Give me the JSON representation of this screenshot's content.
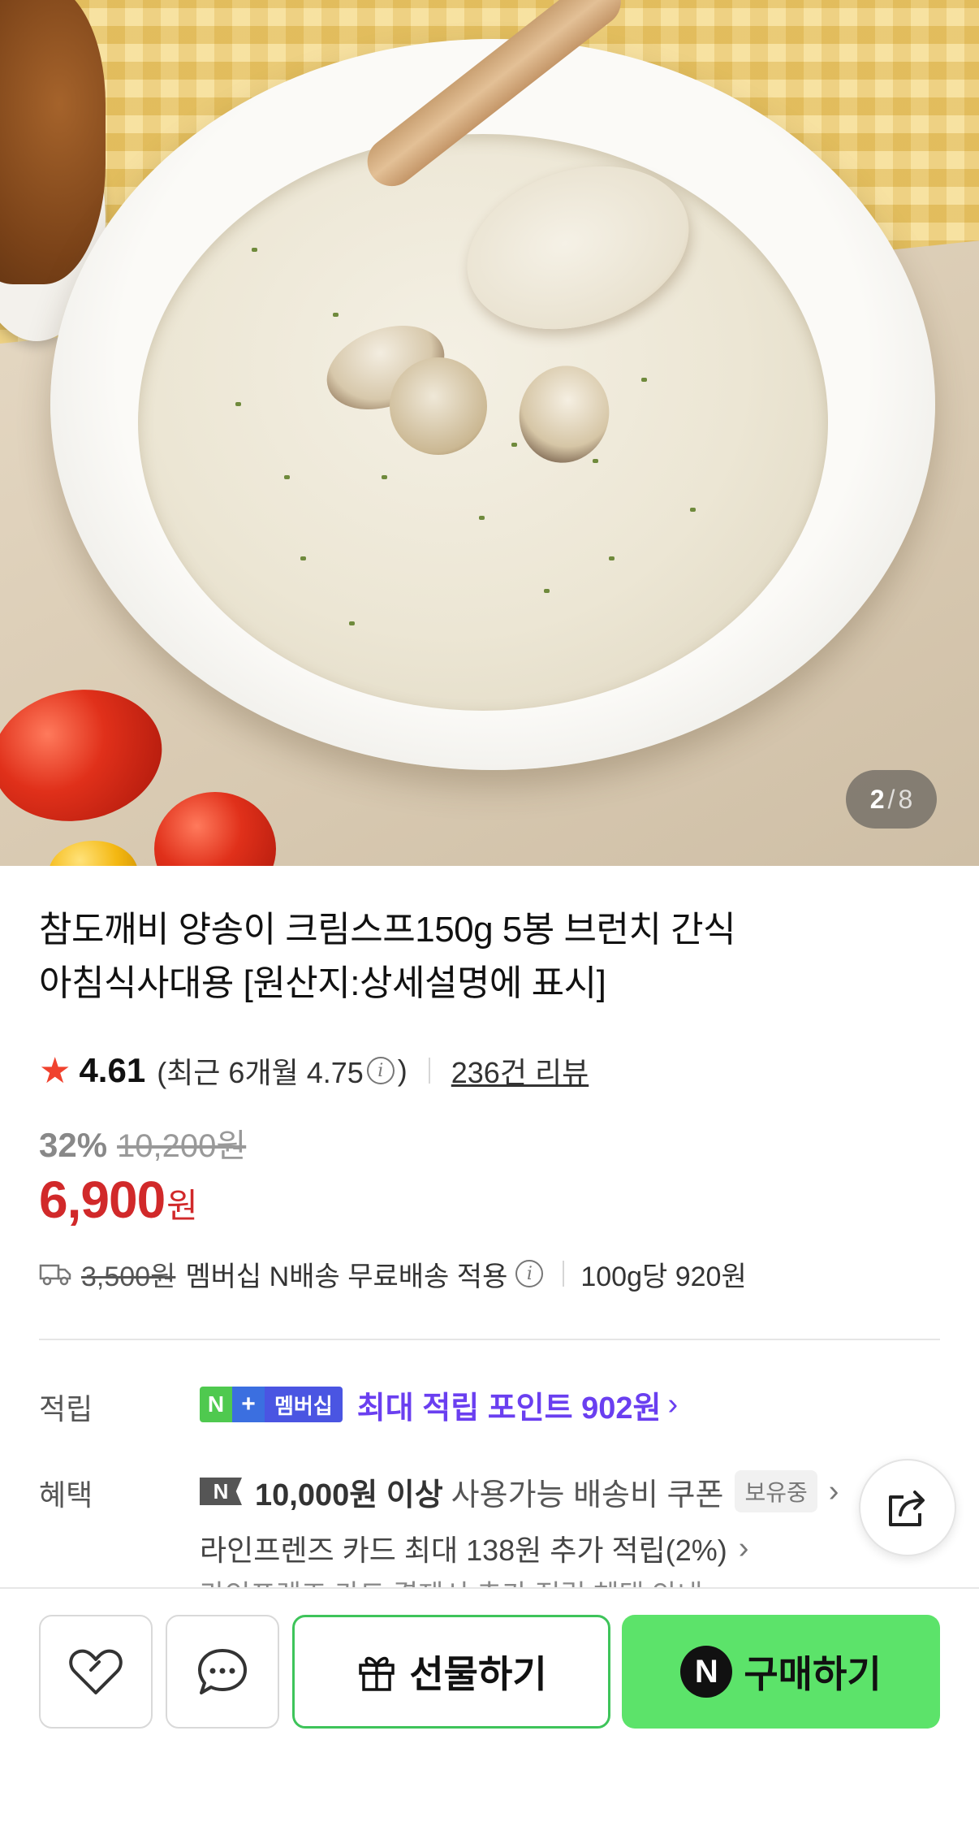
{
  "hero": {
    "image_index": "2",
    "image_separator": "/",
    "image_total": "8",
    "alt": "mushroom cream soup photo"
  },
  "product": {
    "title_line1": "참도깨비 양송이 크림스프150g 5봉 브런치 간식",
    "title_line2": "아침식사대용 [원산지:상세설명에 표시]",
    "rating": "4.61",
    "recent_rating_open": "(최근 6개월 4.75",
    "recent_rating_close": ")",
    "review_link": "236건 리뷰",
    "discount_pct": "32%",
    "original_price": "10,200원",
    "sale_price": "6,900",
    "sale_unit": "원"
  },
  "shipping": {
    "original_fee": "3,500원",
    "text": "멤버십 N배송 무료배송 적용",
    "unit_price": "100g당 920원"
  },
  "points": {
    "label": "적립",
    "badge_n": "N",
    "badge_plus": "+",
    "badge_membership": "멤버십",
    "text": "최대 적립 포인트 902원"
  },
  "benefits": {
    "label": "혜택",
    "coupon_icon": "N",
    "coupon_amount": "10,000원 이상",
    "coupon_text": "사용가능 배송비 쿠폰",
    "owned_badge": "보유중",
    "card_text": "라인프렌즈 카드 최대 138원 추가 적립(2%)",
    "partial_text": "라인프렌즈 카드 결제시 추가 적립 혜택 안내"
  },
  "actions": {
    "gift_label": "선물하기",
    "buy_label": "구매하기",
    "npay_glyph": "N"
  },
  "colors": {
    "sale_red": "#d1292a",
    "points_purple": "#6a3ff0",
    "buy_green": "#5ce36a",
    "gift_border": "#3ec45a",
    "star": "#f0422e"
  }
}
